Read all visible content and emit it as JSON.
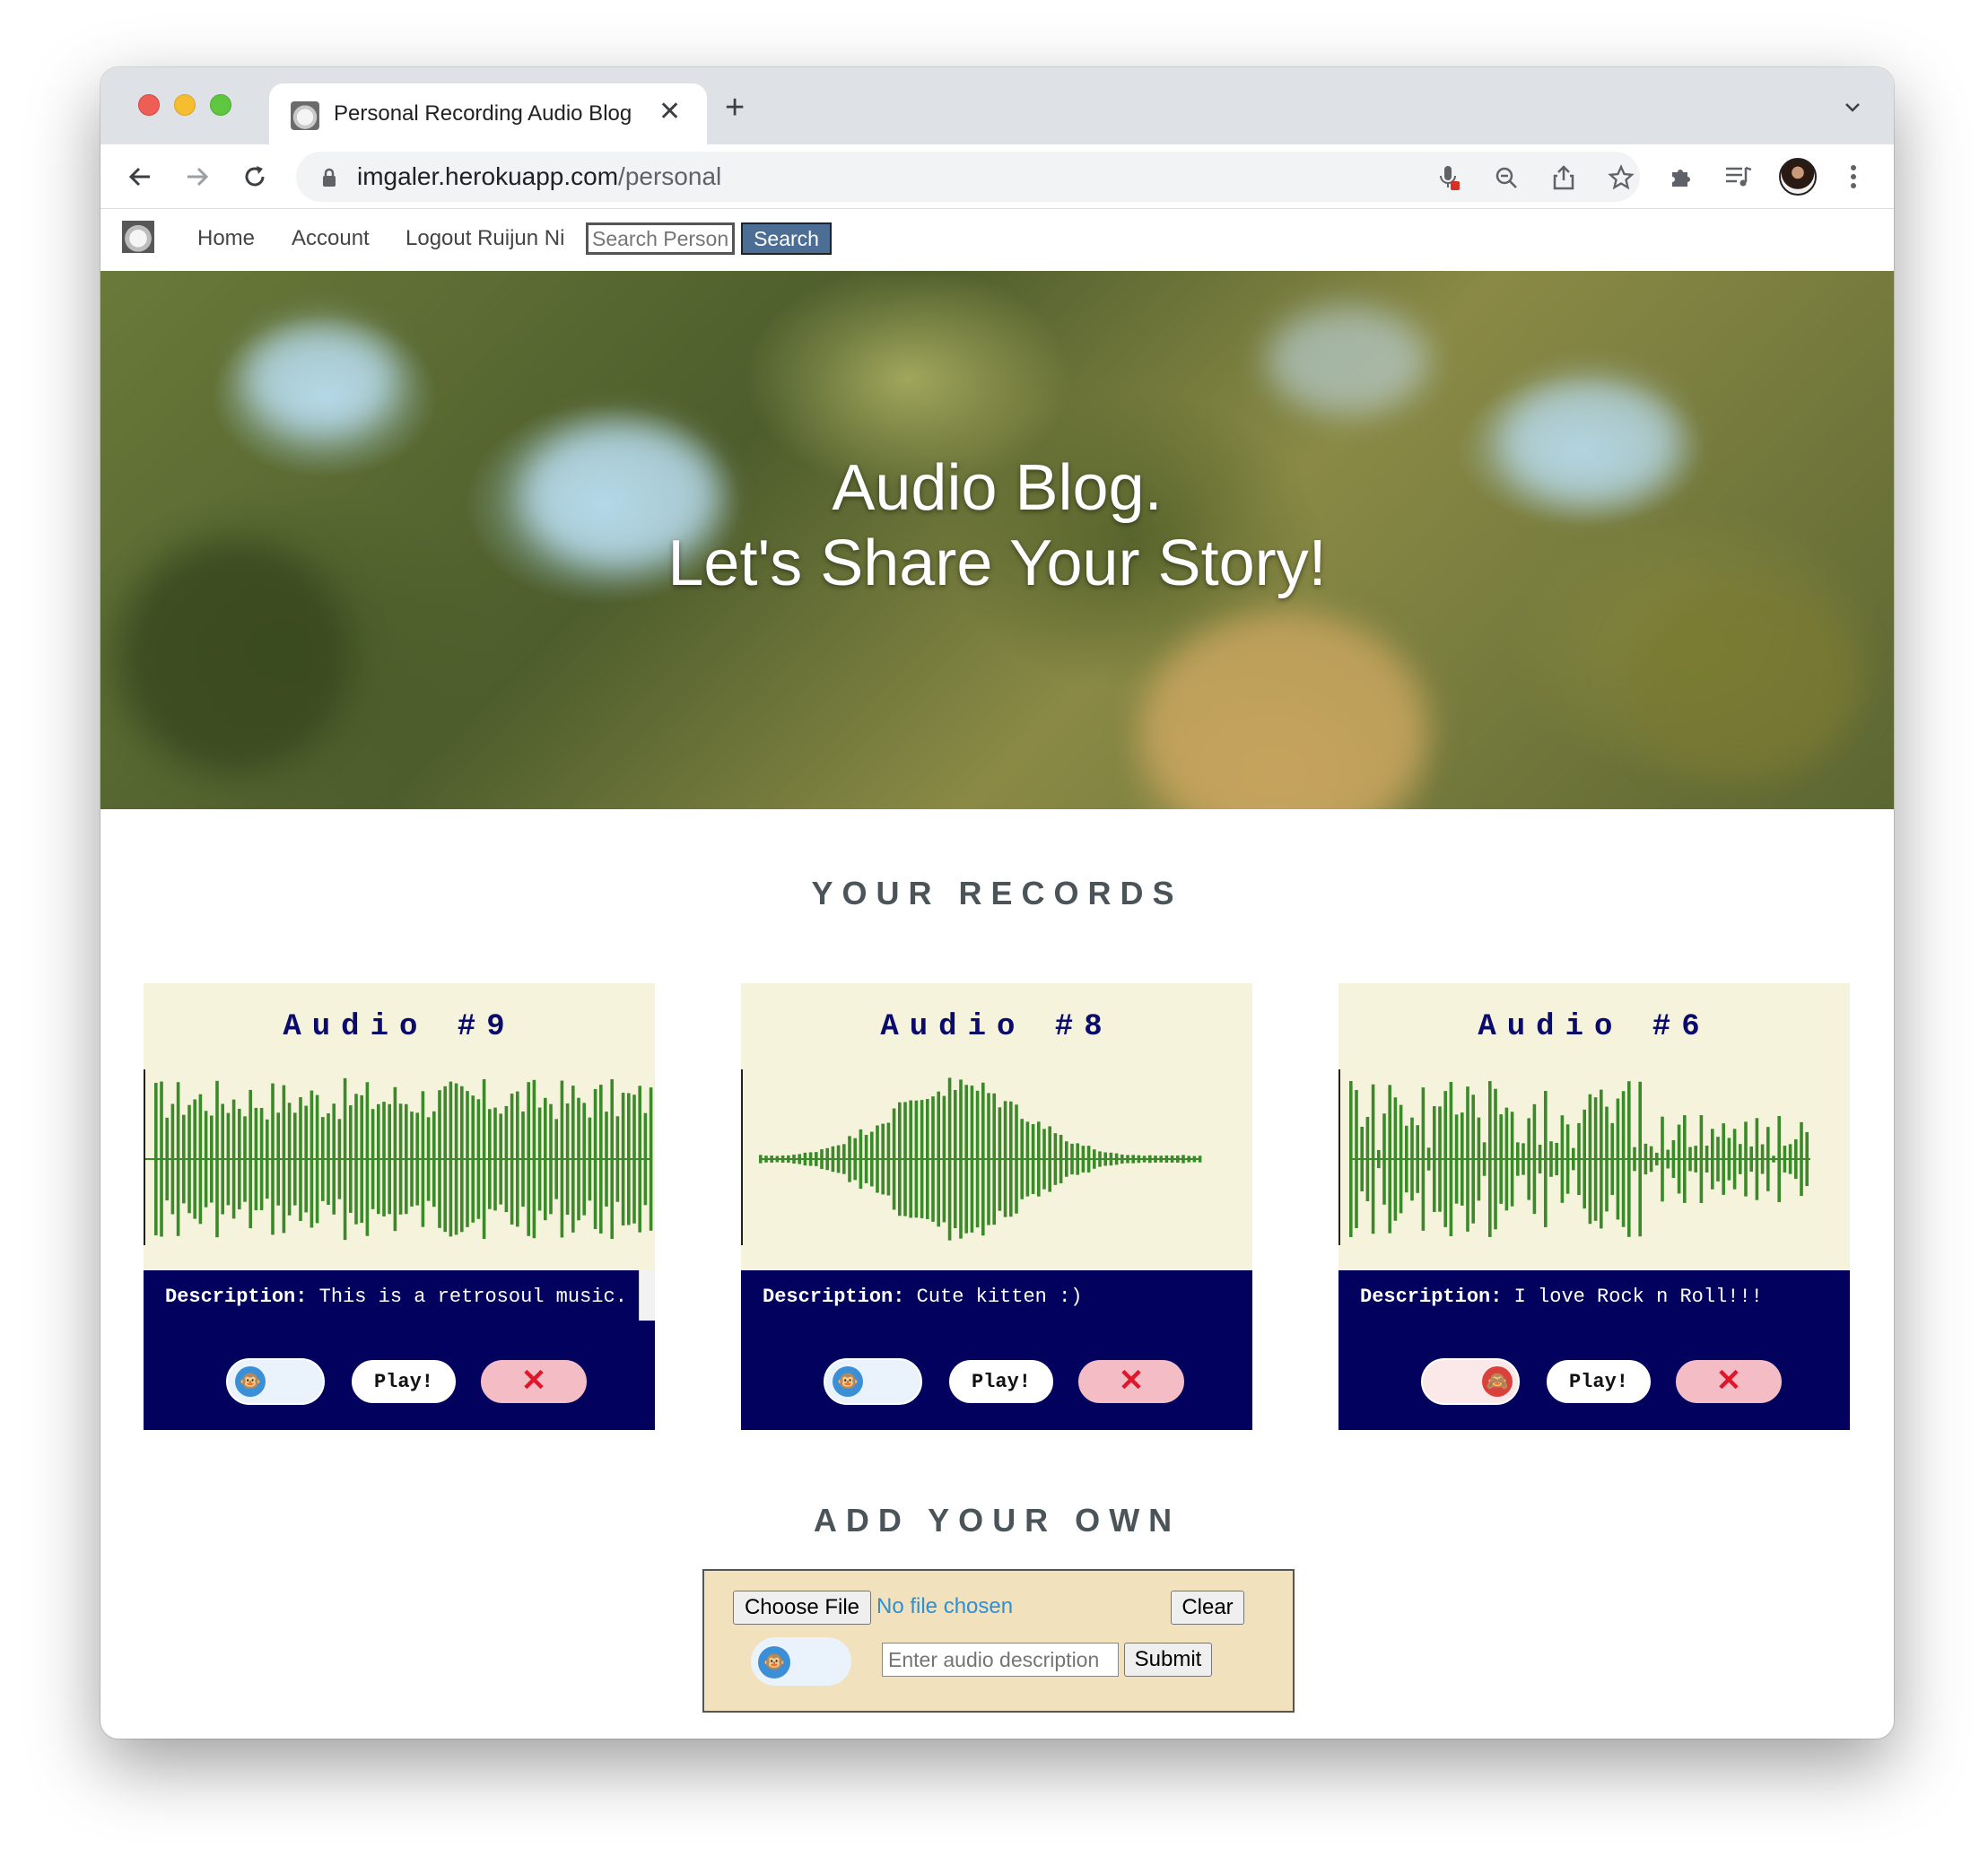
{
  "browser": {
    "tab_title": "Personal Recording Audio Blog",
    "tab_close": "✕",
    "new_tab": "+",
    "url_host": "imgaler.herokuapp.com",
    "url_path": "/personal"
  },
  "nav": {
    "home": "Home",
    "account": "Account",
    "logout": "Logout Ruijun Ni",
    "search_placeholder": "Search Person",
    "search_button": "Search"
  },
  "hero": {
    "line1": "Audio Blog.",
    "line2": "Let's Share Your Story!"
  },
  "records": {
    "title": "YOUR RECORDS",
    "items": [
      {
        "title": "Audio #9",
        "desc_label": "Description:",
        "desc": "This is a retrosoul music.",
        "play": "Play!",
        "delete": "✕",
        "toggle_on": false
      },
      {
        "title": "Audio #8",
        "desc_label": "Description:",
        "desc": "Cute kitten :)",
        "play": "Play!",
        "delete": "✕",
        "toggle_on": false
      },
      {
        "title": "Audio #6",
        "desc_label": "Description:",
        "desc": "I love Rock n Roll!!!",
        "play": "Play!",
        "delete": "✕",
        "toggle_on": true
      }
    ]
  },
  "add": {
    "title": "ADD YOUR OWN",
    "choose_file": "Choose File",
    "no_file": "No file chosen",
    "clear": "Clear",
    "desc_placeholder": "Enter audio description",
    "submit": "Submit"
  },
  "colors": {
    "waveform": "#3a8a2a",
    "card_top": "#f5f3dc",
    "card_bottom": "#02025e",
    "search_button": "#4c6e95"
  },
  "icons": [
    "back-icon",
    "forward-icon",
    "reload-icon",
    "lock-icon",
    "mic-blocked-icon",
    "zoom-icon",
    "share-icon",
    "star-icon",
    "extensions-icon",
    "media-icon",
    "menu-icon",
    "monkey-icon"
  ]
}
